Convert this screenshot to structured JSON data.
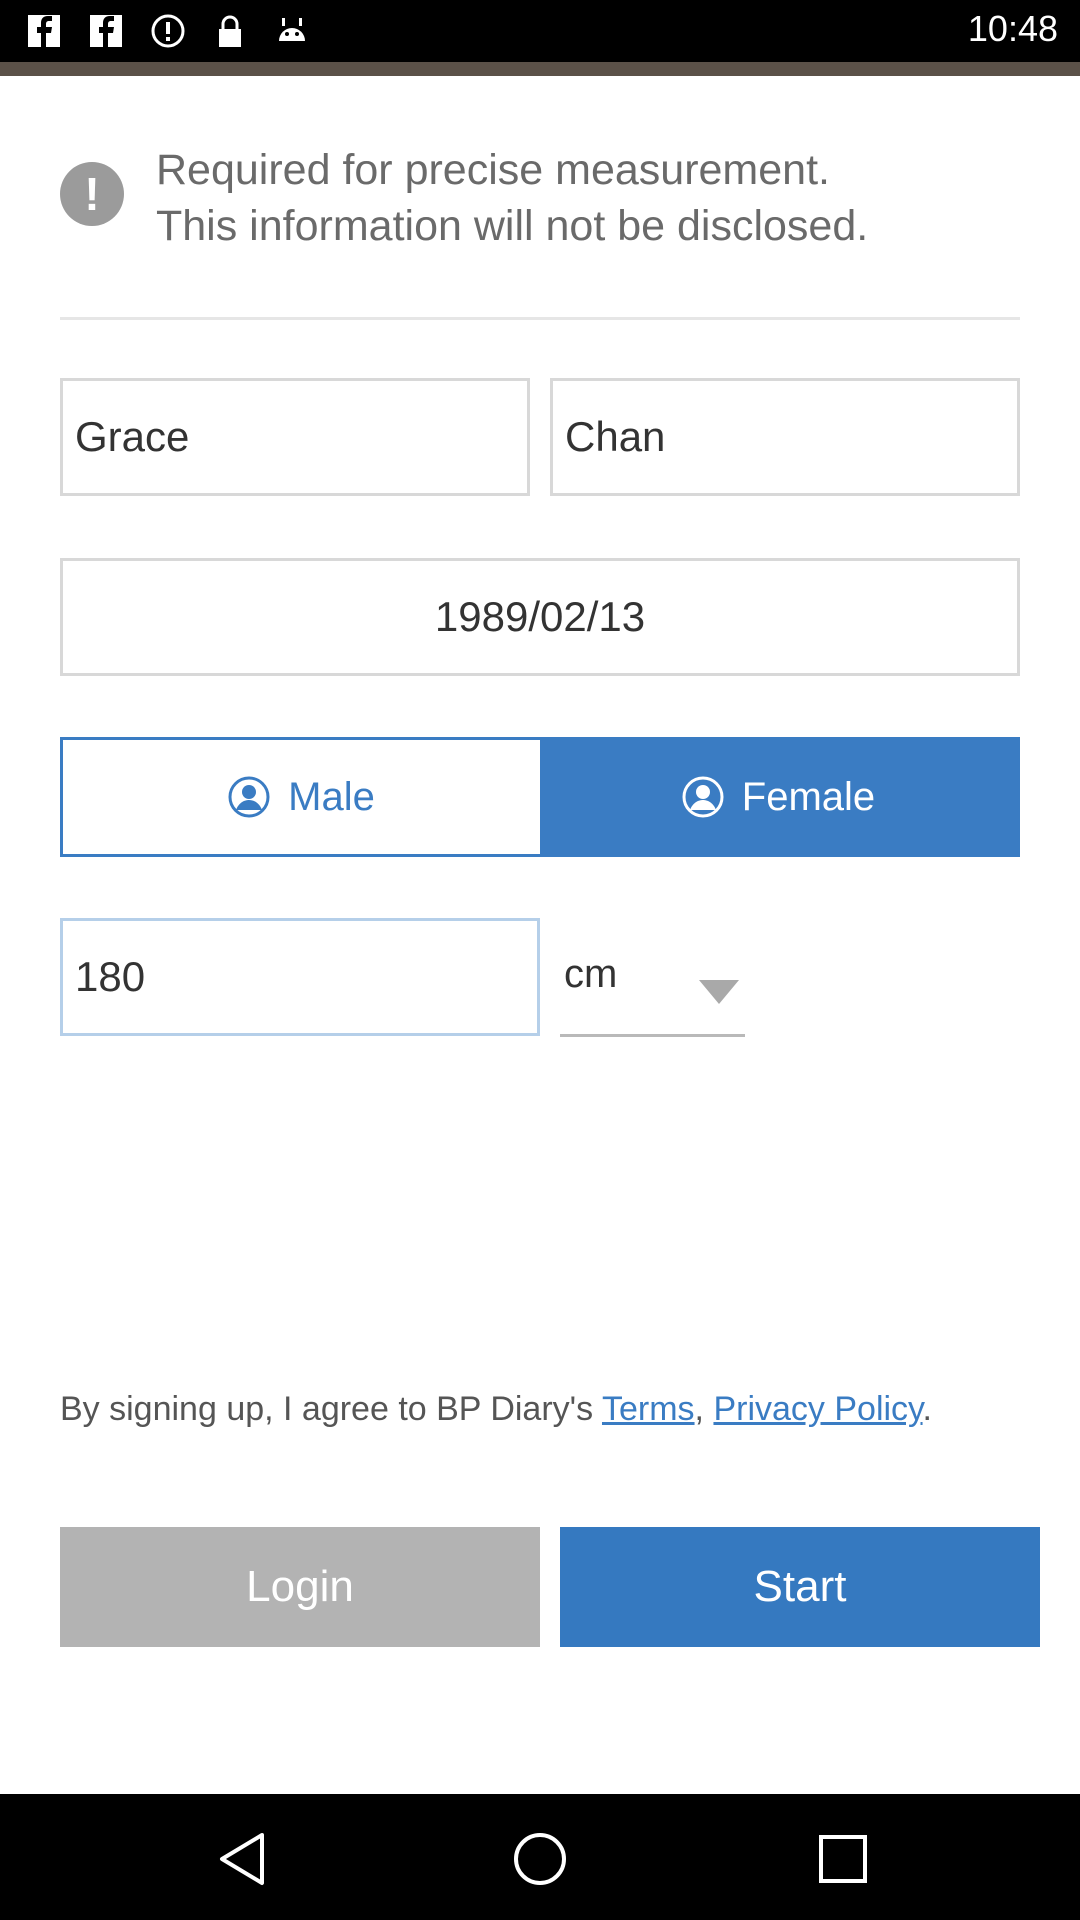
{
  "status_bar": {
    "time": "10:48",
    "icons": [
      "facebook-icon",
      "facebook-icon",
      "alert-circle-icon",
      "lock-icon",
      "android-icon"
    ]
  },
  "notice": {
    "icon": "exclamation-icon",
    "line1": "Required for precise measurement.",
    "line2": "This information will not be disclosed."
  },
  "form": {
    "first_name": "Grace",
    "last_name": "Chan",
    "birth_date": "1989/02/13",
    "gender": {
      "male_label": "Male",
      "female_label": "Female",
      "selected": "Female"
    },
    "height": {
      "value": "180",
      "unit": "cm"
    }
  },
  "agreement": {
    "prefix": "By signing up, I agree to BP Diary's ",
    "terms_link": "Terms",
    "separator": ", ",
    "privacy_link": "Privacy Policy",
    "suffix": "."
  },
  "buttons": {
    "login": "Login",
    "start": "Start"
  },
  "colors": {
    "accent": "#3579c0",
    "disabled": "#b3b3b3"
  },
  "nav_bar": {
    "icons": [
      "back-icon",
      "home-icon",
      "recents-icon"
    ]
  }
}
